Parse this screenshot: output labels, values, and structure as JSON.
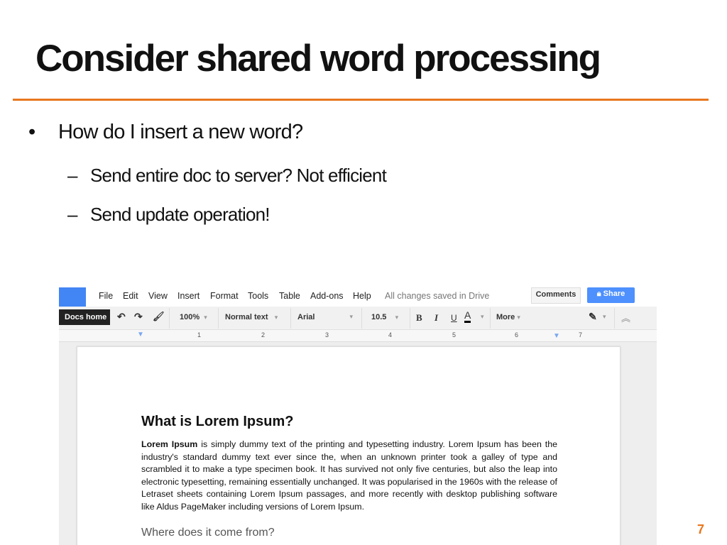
{
  "slide": {
    "title": "Consider shared word processing",
    "bullet": "How do I insert a new word?",
    "subbullets": [
      "Send entire doc to server?  Not efficient",
      "Send update operation!"
    ],
    "page_number": "7",
    "accent_color": "#e8771e"
  },
  "docs": {
    "menu": [
      "File",
      "Edit",
      "View",
      "Insert",
      "Format",
      "Tools",
      "Table",
      "Add-ons",
      "Help"
    ],
    "status": "All changes saved in Drive",
    "comments_label": "Comments",
    "share_label": "Share",
    "tooltip": "Docs home",
    "zoom": "100%",
    "style": "Normal text",
    "font": "Arial",
    "size": "10.5",
    "bold": "B",
    "italic": "I",
    "underline": "U",
    "color": "A",
    "more": "More",
    "ruler": [
      "1",
      "2",
      "3",
      "4",
      "5",
      "6",
      "7"
    ],
    "heading": "What is Lorem Ipsum?",
    "para_bold": "Lorem Ipsum",
    "para": " is simply dummy text of the printing and typesetting industry. Lorem Ipsum has been the industry's standard dummy text ever since the, when an unknown printer took a galley of type and scrambled it to make a type specimen book. It has survived not only five centuries, but also the leap into electronic typesetting, remaining essentially unchanged. It was popularised in the 1960s with the release of Letraset sheets containing Lorem Ipsum passages, and more recently with desktop publishing software like Aldus PageMaker including versions of Lorem Ipsum.",
    "heading2": "Where does it come from?"
  }
}
